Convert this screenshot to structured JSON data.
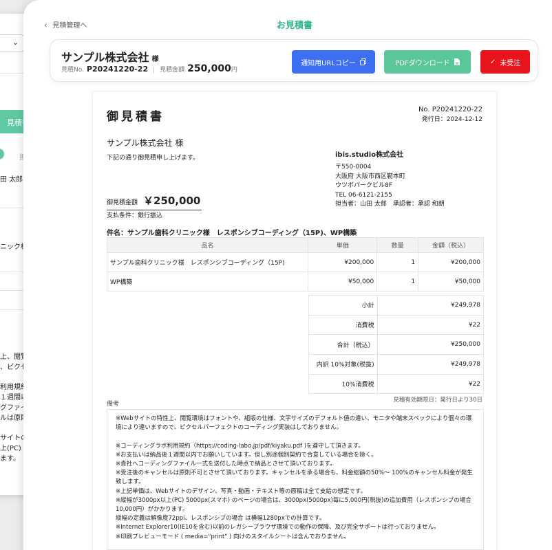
{
  "bg": {
    "select_glyph": "⌄",
    "button_label": "見積書",
    "frag1": "担",
    "frag2": "田 太郎",
    "frag3": "ニック様",
    "frag4": "上、閲覧",
    "frag5": "、ピクセ",
    "frag6": "利用規約",
    "frag7": "１週間以",
    "frag8": "グファイ",
    "frag9": "ルは原則",
    "frag10": "サイトの",
    "frag11": "上(PC)",
    "frag12": "ます。"
  },
  "header": {
    "back_label": "見積管理へ",
    "page_title": "お見積書"
  },
  "summary": {
    "company": "サンプル株式会社",
    "honorific": "様",
    "no_label": "見積No.",
    "no_value": "P20241220-22",
    "amount_label": "見積金額",
    "amount_value": "250,000",
    "amount_unit": "円"
  },
  "actions": {
    "copy_url": "通知用URLコピー",
    "pdf": "PDFダウンロード",
    "status": "未受注"
  },
  "doc": {
    "title": "御見積書",
    "no": "No. P20241220-22",
    "issued": "発行日：2024-12-12",
    "to": "サンプル株式会社 様",
    "intro": "下記の通り御見積申し上げます。",
    "amount_label": "御見積金額",
    "amount_value": "￥250,000",
    "payment": "支払条件：銀行振込",
    "issuer_name": "ibis.studio株式会社",
    "zip": "〒550-0004",
    "addr1": "大阪府 大阪市西区靭本町",
    "addr2": "ウツボパークビル8F",
    "tel": "TEL 06-6121-2155",
    "staff": "担当者：山田 太郎　承認者：承認 和朗",
    "subject": "件名：サンプル歯科クリニック様　レスポンシブコーディング（15P)、WP構築"
  },
  "table": {
    "headers": [
      "品名",
      "単価",
      "数量",
      "金額（税込）"
    ],
    "rows": [
      [
        "サンプル歯科クリニック様　レスポンシブコーディング（15P)",
        "¥200,000",
        "1",
        "¥200,000"
      ],
      [
        "WP構築",
        "¥50,000",
        "1",
        "¥50,000"
      ]
    ],
    "totals": [
      [
        "小計",
        "¥249,978"
      ],
      [
        "消費税",
        "¥22"
      ],
      [
        "合計（税込）",
        "¥250,000"
      ],
      [
        "内訳 10%対象(税抜)",
        "¥249,978"
      ],
      [
        "10%消費税",
        "¥22"
      ]
    ]
  },
  "validity": "見積有効期限日：発行日より30日",
  "notes_label": "備考",
  "notes": [
    "※Webサイトの特性上、閲覧環境はフォントや、組版の仕様、文字サイズのデフォルト値の違い、モニタや端末スペックにより個々の環境により違いますので、ピクセルパーフェクトのコーディング実装はしておりません。",
    "",
    "※コーディングラボ利用規約（https://coding-labo.jp/pdf/kiyaku.pdf )を遵守して頂きます。",
    "※お支払いは納品後１週間以内でお願いしています。但し別途個別契約で合意している場合を除く。",
    "※貴社へコーディングファイル一式を送付した時点で納品とさせて頂いております。",
    "※受注後のキャンセルは原則不可とさせて頂いております。キャンセルを承る場合も、料金総額の50%～ 100%のキャンセル料金が発生致します。",
    "※上記単価は、Webサイトのデザイン、写真・動画・テキスト等の原稿は全て支給の想定です。",
    "※縦幅が3000px以上(PC) 5000px(スマホ) のページの場合は、3000px(5000px)毎に5,000円(税抜)の追加費用（レスポンシブの場合10,000円）がかかります。",
    "縦幅の定義は解像度72ppi、レスポンシブの場合 は横幅1280pxでの計算です。",
    "※Internet Explorer10(IE10を含む)以前のレガシーブラウザ環境での動作の保障、及び完全サポートは行っておりません。",
    "※印刷プレビューモード ( media=\"print\" ) 向けのスタイルシートは含んでおりません。"
  ]
}
